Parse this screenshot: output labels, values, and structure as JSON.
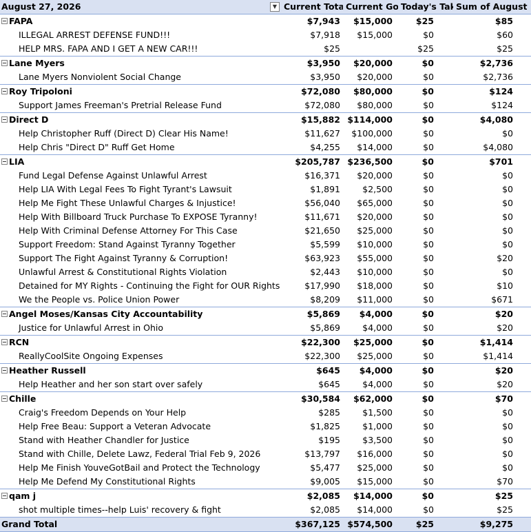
{
  "header": {
    "date_label": "August 27, 2026",
    "columns": [
      "Current Total",
      "Current Goal",
      "Today's Take",
      "Sum of August"
    ]
  },
  "groups": [
    {
      "name": "FAPA",
      "totals": [
        "$7,943",
        "$15,000",
        "$25",
        "$85"
      ],
      "items": [
        {
          "label": "ILLEGAL ARREST DEFENSE FUND!!!",
          "values": [
            "$7,918",
            "$15,000",
            "$0",
            "$60"
          ]
        },
        {
          "label": "HELP MRS. FAPA AND I GET A NEW CAR!!!",
          "values": [
            "$25",
            "",
            "$25",
            "$25"
          ]
        }
      ]
    },
    {
      "name": "Lane Myers",
      "totals": [
        "$3,950",
        "$20,000",
        "$0",
        "$2,736"
      ],
      "items": [
        {
          "label": "Lane Myers Nonviolent Social Change",
          "values": [
            "$3,950",
            "$20,000",
            "$0",
            "$2,736"
          ]
        }
      ]
    },
    {
      "name": "Roy Tripoloni",
      "totals": [
        "$72,080",
        "$80,000",
        "$0",
        "$124"
      ],
      "items": [
        {
          "label": "Support James Freeman's Pretrial Release Fund",
          "values": [
            "$72,080",
            "$80,000",
            "$0",
            "$124"
          ]
        }
      ]
    },
    {
      "name": "Direct D",
      "totals": [
        "$15,882",
        "$114,000",
        "$0",
        "$4,080"
      ],
      "items": [
        {
          "label": "Help Christopher Ruff (Direct D) Clear His Name!",
          "values": [
            "$11,627",
            "$100,000",
            "$0",
            "$0"
          ]
        },
        {
          "label": "Help Chris \"Direct D\" Ruff Get Home",
          "values": [
            "$4,255",
            "$14,000",
            "$0",
            "$4,080"
          ]
        }
      ]
    },
    {
      "name": "LIA",
      "totals": [
        "$205,787",
        "$236,500",
        "$0",
        "$701"
      ],
      "items": [
        {
          "label": "Fund Legal Defense Against Unlawful Arrest",
          "values": [
            "$16,371",
            "$20,000",
            "$0",
            "$0"
          ]
        },
        {
          "label": "Help LIA With Legal Fees To Fight Tyrant's Lawsuit",
          "values": [
            "$1,891",
            "$2,500",
            "$0",
            "$0"
          ]
        },
        {
          "label": "Help Me Fight These Unlawful Charges & Injustice!",
          "values": [
            "$56,040",
            "$65,000",
            "$0",
            "$0"
          ]
        },
        {
          "label": "Help With Billboard Truck Purchase To EXPOSE Tyranny!",
          "values": [
            "$11,671",
            "$20,000",
            "$0",
            "$0"
          ]
        },
        {
          "label": "Help With Criminal Defense Attorney For This Case",
          "values": [
            "$21,650",
            "$25,000",
            "$0",
            "$0"
          ]
        },
        {
          "label": "Support Freedom: Stand Against Tyranny Together",
          "values": [
            "$5,599",
            "$10,000",
            "$0",
            "$0"
          ]
        },
        {
          "label": "Support The Fight Against Tyranny & Corruption!",
          "values": [
            "$63,923",
            "$55,000",
            "$0",
            "$20"
          ]
        },
        {
          "label": "Unlawful Arrest & Constitutional Rights Violation",
          "values": [
            "$2,443",
            "$10,000",
            "$0",
            "$0"
          ]
        },
        {
          "label": "Detained for MY Rights - Continuing the Fight for OUR Rights",
          "values": [
            "$17,990",
            "$18,000",
            "$0",
            "$10"
          ]
        },
        {
          "label": "We the People vs. Police Union Power",
          "values": [
            "$8,209",
            "$11,000",
            "$0",
            "$671"
          ]
        }
      ]
    },
    {
      "name": "Angel Moses/Kansas City Accountability",
      "totals": [
        "$5,869",
        "$4,000",
        "$0",
        "$20"
      ],
      "items": [
        {
          "label": "Justice for Unlawful Arrest in Ohio",
          "values": [
            "$5,869",
            "$4,000",
            "$0",
            "$20"
          ]
        }
      ]
    },
    {
      "name": "RCN",
      "totals": [
        "$22,300",
        "$25,000",
        "$0",
        "$1,414"
      ],
      "items": [
        {
          "label": "ReallyCoolSite Ongoing Expenses",
          "values": [
            "$22,300",
            "$25,000",
            "$0",
            "$1,414"
          ]
        }
      ]
    },
    {
      "name": "Heather Russell",
      "totals": [
        "$645",
        "$4,000",
        "$0",
        "$20"
      ],
      "items": [
        {
          "label": "Help Heather and her son start over safely",
          "values": [
            "$645",
            "$4,000",
            "$0",
            "$20"
          ]
        }
      ]
    },
    {
      "name": "Chille",
      "totals": [
        "$30,584",
        "$62,000",
        "$0",
        "$70"
      ],
      "items": [
        {
          "label": "Craig's Freedom Depends on Your Help",
          "values": [
            "$285",
            "$1,500",
            "$0",
            "$0"
          ]
        },
        {
          "label": "Help Free Beau: Support a Veteran Advocate",
          "values": [
            "$1,825",
            "$1,000",
            "$0",
            "$0"
          ]
        },
        {
          "label": "Stand with Heather Chandler for Justice",
          "values": [
            "$195",
            "$3,500",
            "$0",
            "$0"
          ]
        },
        {
          "label": "Stand with Chille, Delete Lawz, Federal Trial Feb 9, 2026",
          "values": [
            "$13,797",
            "$16,000",
            "$0",
            "$0"
          ]
        },
        {
          "label": "Help Me Finish YouveGotBail and Protect the Technology",
          "values": [
            "$5,477",
            "$25,000",
            "$0",
            "$0"
          ]
        },
        {
          "label": "Help Me Defend My Constitutional Rights",
          "values": [
            "$9,005",
            "$15,000",
            "$0",
            "$70"
          ]
        }
      ]
    },
    {
      "name": "qam j",
      "totals": [
        "$2,085",
        "$14,000",
        "$0",
        "$25"
      ],
      "items": [
        {
          "label": "shot multiple times--help Luis' recovery & fight",
          "values": [
            "$2,085",
            "$14,000",
            "$0",
            "$25"
          ]
        }
      ]
    }
  ],
  "grand_total": {
    "label": "Grand Total",
    "values": [
      "$367,125",
      "$574,500",
      "$25",
      "$9,275"
    ]
  },
  "icons": {
    "filter": "filter-sort-icon",
    "collapse": "collapse-minus-icon"
  },
  "colors": {
    "header_bg": "#d9e1f2",
    "border": "#8ea9db"
  }
}
